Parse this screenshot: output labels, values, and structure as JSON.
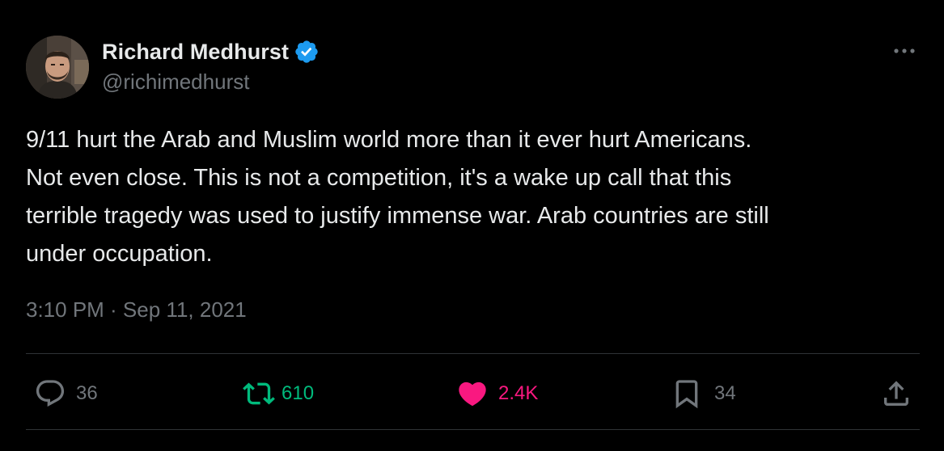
{
  "author": {
    "display_name": "Richard Medhurst",
    "handle": "@richimedhurst",
    "verified": true,
    "verified_color": "#1d9bf0"
  },
  "tweet": {
    "text": "9/11 hurt the Arab and Muslim world more than it ever hurt Americans.\nNot even close. This is not a competition, it's a wake up call that this\nterrible tragedy was used to justify immense war. Arab countries are still\nunder occupation.",
    "timestamp": "3:10 PM · Sep 11, 2021"
  },
  "actions": {
    "reply": {
      "icon": "reply-icon",
      "count": "36"
    },
    "retweet": {
      "icon": "retweet-icon",
      "count": "610",
      "active": true,
      "color": "#00ba7c"
    },
    "like": {
      "icon": "heart-icon",
      "count": "2.4K",
      "active": true,
      "color": "#f91880"
    },
    "bookmark": {
      "icon": "bookmark-icon",
      "count": "34"
    },
    "share": {
      "icon": "share-icon"
    }
  },
  "theme": {
    "background": "#000000",
    "text_primary": "#e7e9ea",
    "text_secondary": "#71767b",
    "divider": "#2f3336"
  }
}
